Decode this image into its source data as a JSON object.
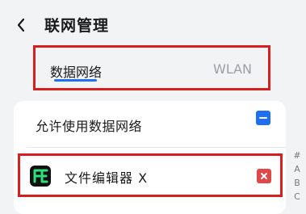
{
  "header": {
    "title": "联网管理"
  },
  "tabs": [
    {
      "label": "数据网络",
      "active": true
    },
    {
      "label": "WLAN",
      "active": false
    }
  ],
  "list": {
    "allow_label": "允许使用数据网络",
    "apps": [
      {
        "name": "文件编辑器 X"
      }
    ]
  },
  "index_bar": [
    "#",
    "A",
    "B",
    "C"
  ],
  "colors": {
    "accent": "#1f6ff2",
    "deny": "#e04848",
    "highlight_border": "#d61f1f",
    "background": "#f1f3f5"
  }
}
